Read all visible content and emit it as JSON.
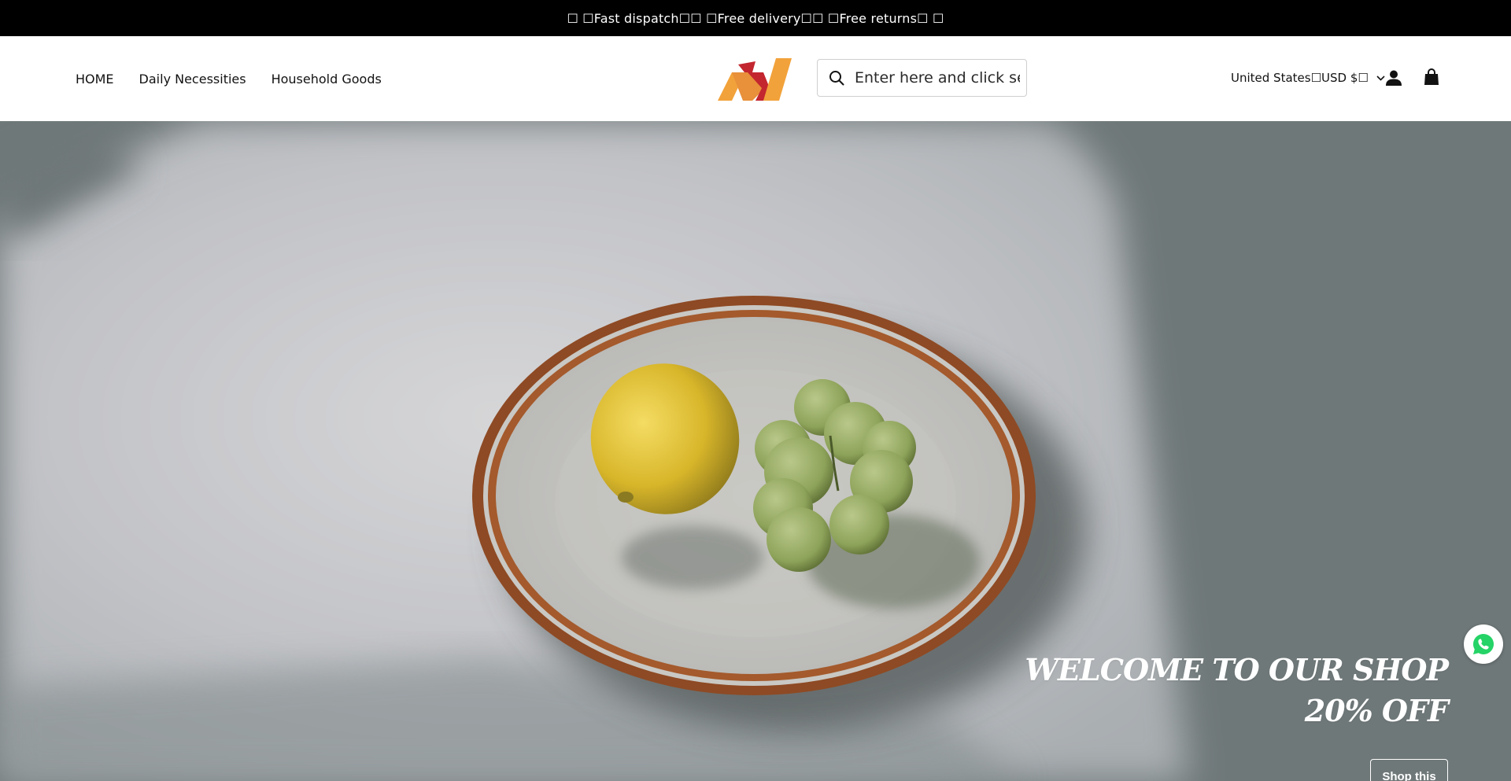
{
  "announcement": {
    "text": "☐ ☐Fast dispatch☐☐ ☐Free delivery☐☐ ☐Free returns☐ ☐"
  },
  "nav": {
    "items": [
      "HOME",
      "Daily Necessities",
      "Household Goods"
    ]
  },
  "logo": {
    "icon": "brand-logo"
  },
  "search": {
    "placeholder": "Enter here and click search",
    "icon": "search-icon"
  },
  "header": {
    "locale_label": "United States☐USD $☐",
    "account_icon": "account-icon",
    "cart_icon": "cart-icon"
  },
  "hero": {
    "heading_line1": "WELCOME TO OUR SHOP",
    "heading_line2": "20% OFF",
    "button_label": "Shop this"
  },
  "floating": {
    "whatsapp_icon": "whatsapp-icon"
  },
  "colors": {
    "announcement_bg": "#000000",
    "hero_bg": "#6d7677",
    "logo_orange": "#f2a23a",
    "logo_red": "#c3262f",
    "whatsapp_green": "#25d366"
  }
}
